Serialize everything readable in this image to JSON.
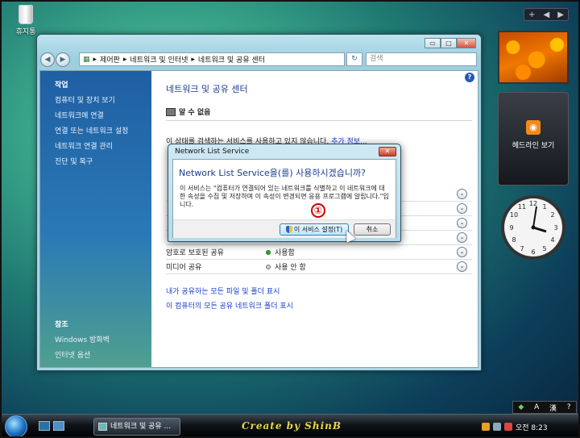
{
  "desktop": {
    "recycle_bin_label": "휴지통"
  },
  "sidebar_gadgets": {
    "controls": {
      "add": "+",
      "prev": "◀",
      "next": "▶"
    },
    "feed_headlines_label": "헤드라인 보기"
  },
  "window": {
    "caption_buttons": {
      "minimize": "▭",
      "maximize": "□",
      "close": "✕"
    },
    "address_bar": {
      "breadcrumb": [
        "제어판",
        "네트워크 및 인터넷",
        "네트워크 및 공유 센터"
      ]
    },
    "search": {
      "placeholder": "검색"
    },
    "tasks_pane": {
      "heading": "작업",
      "links": [
        "컴퓨터 및 장치 보기",
        "네트워크에 연결",
        "연결 또는 네트워크 설정",
        "네트워크 연결 관리",
        "진단 및 복구"
      ],
      "see_also_heading": "참조",
      "see_also_links": [
        "Windows 방화벽",
        "인터넷 옵션"
      ]
    },
    "main": {
      "title": "네트워크 및 공유 센터",
      "network_status": "알 수 없음",
      "message": "이 상태를 검색하는 서비스를 사용하고 있지 않습니다.",
      "more_info_link": "추가 정보...",
      "sharing_rows": [
        {
          "name": "",
          "status": "",
          "state": "hidden"
        },
        {
          "name": "",
          "status": "",
          "state": "hidden"
        },
        {
          "name": "",
          "status": "",
          "state": "hidden"
        },
        {
          "name": "",
          "status": "",
          "state": "hidden"
        },
        {
          "name": "암호로 보호된 공유",
          "status": "사용함",
          "state": "on"
        },
        {
          "name": "미디어 공유",
          "status": "사용 안 함",
          "state": "off"
        }
      ],
      "bottom_links": [
        "내가 공유하는 모든 파일 및 폴더 표시",
        "이 컴퓨터의 모든 공유 네트워크 폴더 표시"
      ]
    }
  },
  "dialog": {
    "title": "Network List Service",
    "question": "Network List Service을(를) 사용하시겠습니까?",
    "description": "이 서비스는 \"컴퓨터가 연결되어 있는 네트워크를 식별하고 이 네트워크에 대한 속성을 수집 및 저장하며 이 속성이 변경되면 응용 프로그램에 알립니다.\"입니다.",
    "primary_button": "이 서비스 설정(T)",
    "cancel_button": "취소",
    "close_glyph": "✕"
  },
  "annotation": {
    "step_number": "①"
  },
  "taskbar": {
    "task_button_label": "네트워크 및 공유 ...",
    "credit_text": "Create by ShinB",
    "clock_text": "오전 8:23",
    "language_bar": {
      "mode": "A",
      "hanja": "漢",
      "help": "?"
    }
  },
  "colors": {
    "accent": "#1c3c8c",
    "link": "#1a3fd0",
    "annotation": "#cc0000"
  }
}
